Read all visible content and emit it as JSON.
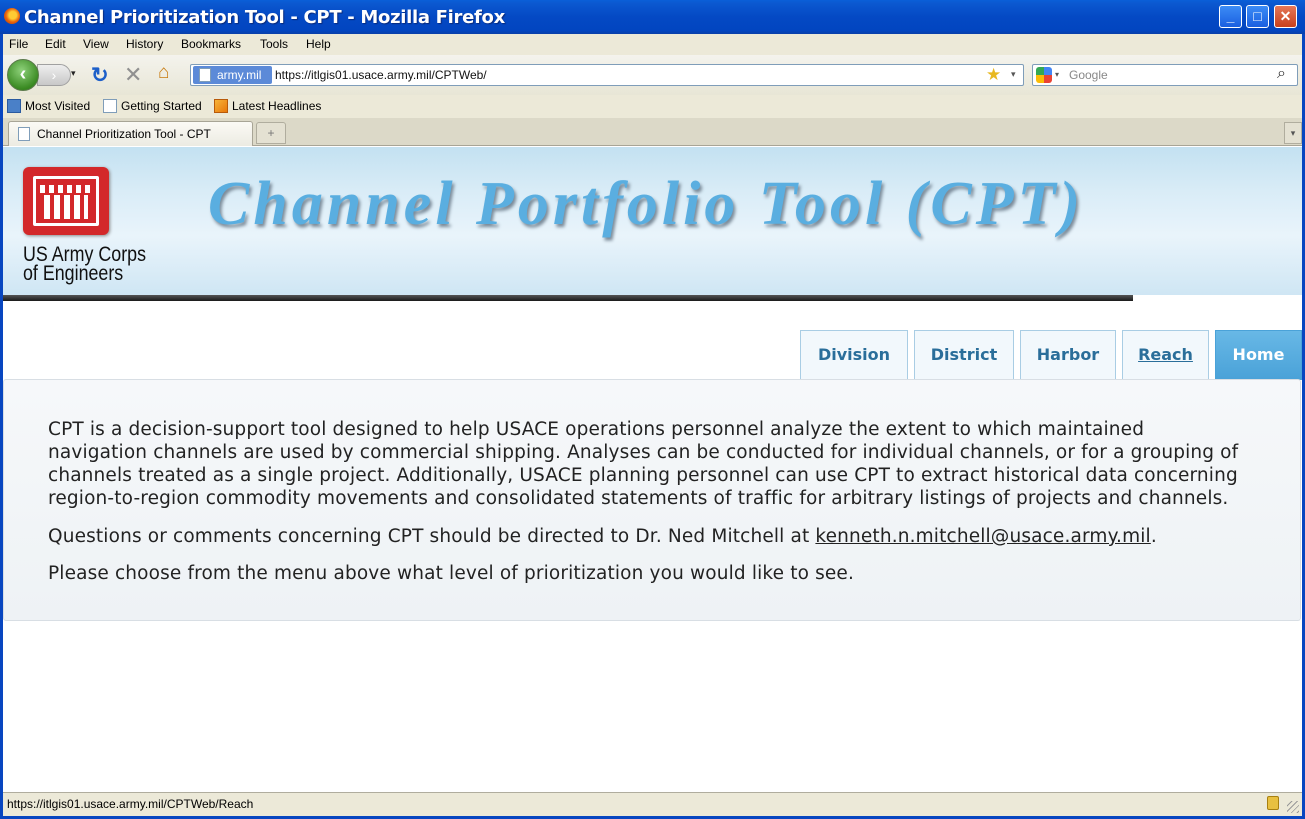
{
  "window": {
    "title": "Channel Prioritization Tool - CPT - Mozilla Firefox",
    "controls": {
      "minimize": "_",
      "maximize": "□",
      "close": "✕"
    }
  },
  "menu": [
    {
      "label": "File"
    },
    {
      "label": "Edit"
    },
    {
      "label": "View"
    },
    {
      "label": "History"
    },
    {
      "label": "Bookmarks"
    },
    {
      "label": "Tools"
    },
    {
      "label": "Help"
    }
  ],
  "toolbar": {
    "back_glyph": "‹",
    "forward_glyph": "›",
    "reload_glyph": "↻",
    "stop_glyph": "✕",
    "home_glyph": "⌂",
    "site_identity": "army.mil",
    "url": "https://itlgis01.usace.army.mil/CPTWeb/",
    "search_placeholder": "Google"
  },
  "bookmarks": [
    {
      "label": "Most Visited",
      "icon": "most-visited-icon"
    },
    {
      "label": "Getting Started",
      "icon": "page-icon"
    },
    {
      "label": "Latest Headlines",
      "icon": "rss-icon"
    }
  ],
  "tabs": {
    "active_label": "Channel Prioritization Tool - CPT",
    "new_tab_glyph": "+",
    "list_glyph": "▾"
  },
  "banner": {
    "org_line1": "US Army Corps",
    "org_line2": "of Engineers",
    "title": "Channel Portfolio Tool (CPT)"
  },
  "nav": {
    "division": "Division",
    "district": "District",
    "harbor": "Harbor",
    "reach": "Reach",
    "home": "Home"
  },
  "content": {
    "p1": "CPT is a decision-support tool designed to help USACE operations personnel analyze the extent to which maintained navigation channels are used by commercial shipping. Analyses can be conducted for individual channels, or for a grouping of channels treated as a single project. Additionally, USACE planning personnel can use CPT to extract historical data concerning region-to-region commodity movements and consolidated statements of traffic for arbitrary listings of projects and channels.",
    "p2_prefix": "Questions or comments concerning CPT should be directed to Dr. Ned Mitchell at ",
    "p2_email": "kenneth.n.mitchell@usace.army.mil",
    "p2_suffix": ".",
    "p3": "Please choose from the menu above what level of prioritization you would like to see."
  },
  "status": {
    "text": "https://itlgis01.usace.army.mil/CPTWeb/Reach"
  }
}
